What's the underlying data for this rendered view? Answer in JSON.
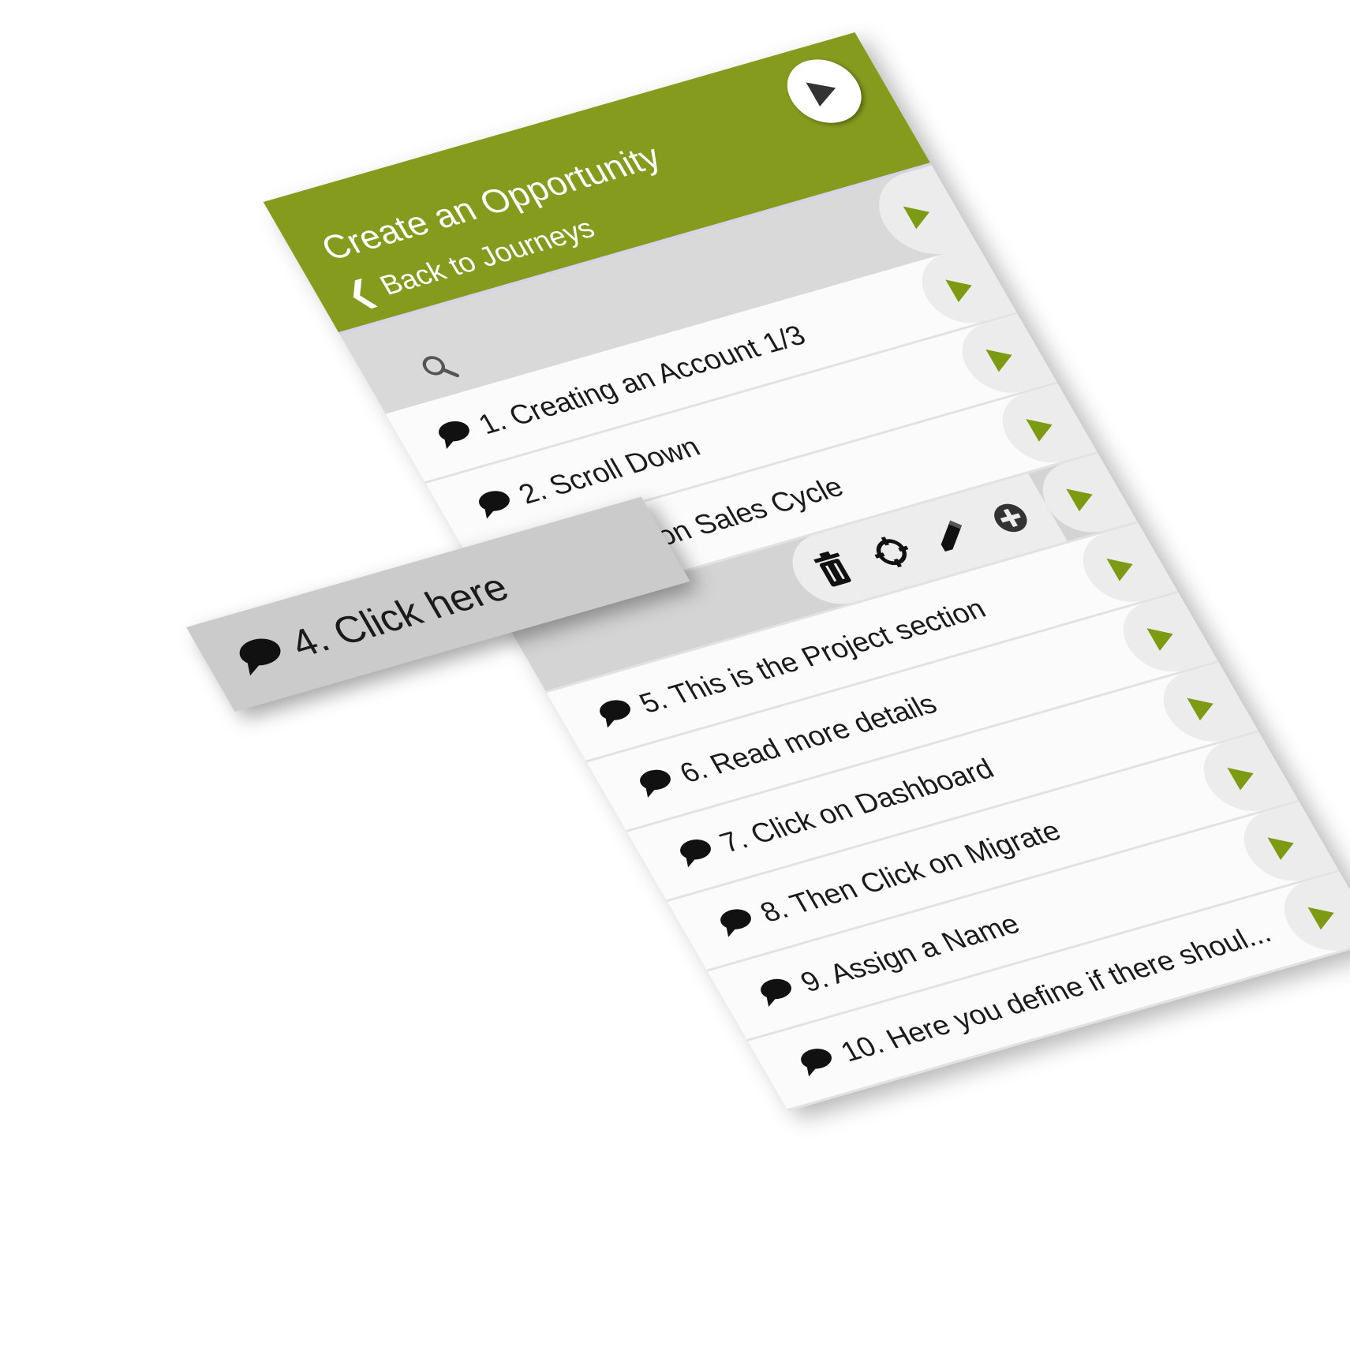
{
  "header": {
    "title": "Create an Opportunity",
    "back_label": "Back to Journeys"
  },
  "search": {
    "placeholder": ""
  },
  "steps": [
    {
      "label": "1. Creating an Account 1/3"
    },
    {
      "label": "2. Scroll Down"
    },
    {
      "label": "3. Click on Sales Cycle"
    },
    {
      "label": "4. Click here"
    },
    {
      "label": "5. This is the Project section"
    },
    {
      "label": "6. Read more details"
    },
    {
      "label": "7. Click on Dashboard"
    },
    {
      "label": "8. Then Click on Migrate"
    },
    {
      "label": "9. Assign a Name"
    },
    {
      "label": "10. Here you define if there shoul..."
    }
  ],
  "colors": {
    "brand_green": "#849b1e",
    "play_green": "#7c9a12",
    "row_bg": "#fbfbfb",
    "active_row_bg": "#cbcbcb"
  },
  "icons": {
    "header_play": "play-icon",
    "back": "chevron-left-icon",
    "search": "search-icon",
    "step_bubble": "speech-bubble-icon",
    "step_play": "play-icon",
    "toolbar": [
      "trash-icon",
      "target-icon",
      "pencil-icon",
      "plus-circle-icon"
    ]
  }
}
